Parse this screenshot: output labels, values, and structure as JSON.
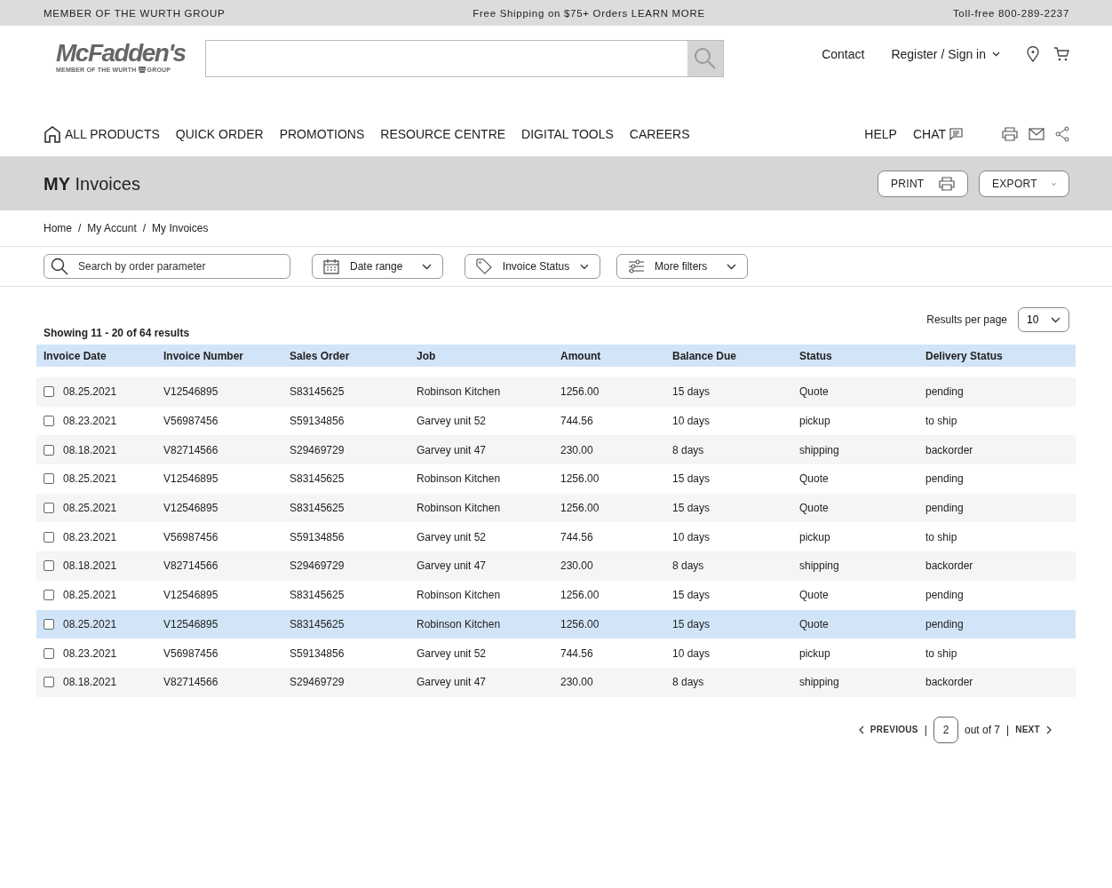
{
  "top_bar": {
    "left": "MEMBER OF THE WURTH GROUP",
    "center": "Free Shipping on $75+ Orders LEARN MORE",
    "right": "Toll-free 800-289-2237"
  },
  "logo": {
    "name": "McFadden's",
    "tagline_1": "MEMBER OF THE WURTH",
    "tagline_2": "GROUP"
  },
  "header_links": [
    {
      "label": "Contact",
      "kind": "link"
    },
    {
      "label": "Register / Sign in",
      "kind": "dropdown"
    }
  ],
  "nav": [
    {
      "label": "ALL PRODUCTS",
      "kind": "home"
    },
    {
      "label": "QUICK ORDER",
      "kind": "link"
    },
    {
      "label": "PROMOTIONS",
      "kind": "link"
    },
    {
      "label": "RESOURCE CENTRE",
      "kind": "link"
    },
    {
      "label": "DIGITAL TOOLS",
      "kind": "link"
    },
    {
      "label": "CAREERS",
      "kind": "link"
    }
  ],
  "nav_right": [
    {
      "label": "HELP",
      "kind": "link"
    },
    {
      "label": "CHAT",
      "kind": "chat"
    }
  ],
  "page_title": {
    "bold": "MY",
    "rest": "Invoices"
  },
  "title_buttons": [
    {
      "label": "PRINT",
      "kind": "print"
    },
    {
      "label": "EXPORT",
      "kind": "dropdown"
    }
  ],
  "breadcrumb": {
    "separator": "/",
    "items": [
      "Home",
      "My Accunt",
      "My Invoices"
    ]
  },
  "filters": {
    "search_placeholder": "Search by order parameter",
    "dropdowns": [
      {
        "label": "Date range",
        "kind": "calendar"
      },
      {
        "label": "Invoice Status",
        "kind": "tag"
      },
      {
        "label": "More filters",
        "kind": "sliders"
      }
    ]
  },
  "results": {
    "summary": "Showing 11 - 20 of 64 results",
    "per_page_label": "Results per page",
    "per_page": "10"
  },
  "table": {
    "columns": [
      "Invoice Date",
      "Invoice Number",
      "Sales Order",
      "Job",
      "Amount",
      "Balance Due",
      "Status",
      "Delivery Status"
    ],
    "rows": [
      {
        "selected": false,
        "checked": false,
        "cells": [
          "08.25.2021",
          "V12546895",
          "S83145625",
          "Robinson Kitchen",
          "1256.00",
          "15 days",
          "Quote",
          "pending"
        ]
      },
      {
        "selected": false,
        "checked": false,
        "cells": [
          "08.23.2021",
          "V56987456",
          "S59134856",
          "Garvey unit 52",
          "744.56",
          "10 days",
          "pickup",
          "to ship"
        ]
      },
      {
        "selected": false,
        "checked": false,
        "cells": [
          "08.18.2021",
          "V82714566",
          "S29469729",
          "Garvey unit 47",
          "230.00",
          "8 days",
          "shipping",
          "backorder"
        ]
      },
      {
        "selected": false,
        "checked": false,
        "cells": [
          "08.25.2021",
          "V12546895",
          "S83145625",
          "Robinson Kitchen",
          "1256.00",
          "15 days",
          "Quote",
          "pending"
        ]
      },
      {
        "selected": false,
        "checked": false,
        "cells": [
          "08.25.2021",
          "V12546895",
          "S83145625",
          "Robinson Kitchen",
          "1256.00",
          "15 days",
          "Quote",
          "pending"
        ]
      },
      {
        "selected": false,
        "checked": false,
        "cells": [
          "08.23.2021",
          "V56987456",
          "S59134856",
          "Garvey unit 52",
          "744.56",
          "10 days",
          "pickup",
          "to ship"
        ]
      },
      {
        "selected": false,
        "checked": false,
        "cells": [
          "08.18.2021",
          "V82714566",
          "S29469729",
          "Garvey unit 47",
          "230.00",
          "8 days",
          "shipping",
          "backorder"
        ]
      },
      {
        "selected": false,
        "checked": false,
        "cells": [
          "08.25.2021",
          "V12546895",
          "S83145625",
          "Robinson Kitchen",
          "1256.00",
          "15 days",
          "Quote",
          "pending"
        ]
      },
      {
        "selected": true,
        "checked": false,
        "cells": [
          "08.25.2021",
          "V12546895",
          "S83145625",
          "Robinson Kitchen",
          "1256.00",
          "15 days",
          "Quote",
          "pending"
        ]
      },
      {
        "selected": false,
        "checked": false,
        "cells": [
          "08.23.2021",
          "V56987456",
          "S59134856",
          "Garvey unit 52",
          "744.56",
          "10 days",
          "pickup",
          "to ship"
        ]
      },
      {
        "selected": false,
        "checked": false,
        "cells": [
          "08.18.2021",
          "V82714566",
          "S29469729",
          "Garvey unit 47",
          "230.00",
          "8 days",
          "shipping",
          "backorder"
        ]
      }
    ]
  },
  "pagination": {
    "previous": "PREVIOUS",
    "divider_1": "|",
    "page": "2",
    "total": "out of 7",
    "divider_2": "|",
    "next": "NEXT"
  }
}
